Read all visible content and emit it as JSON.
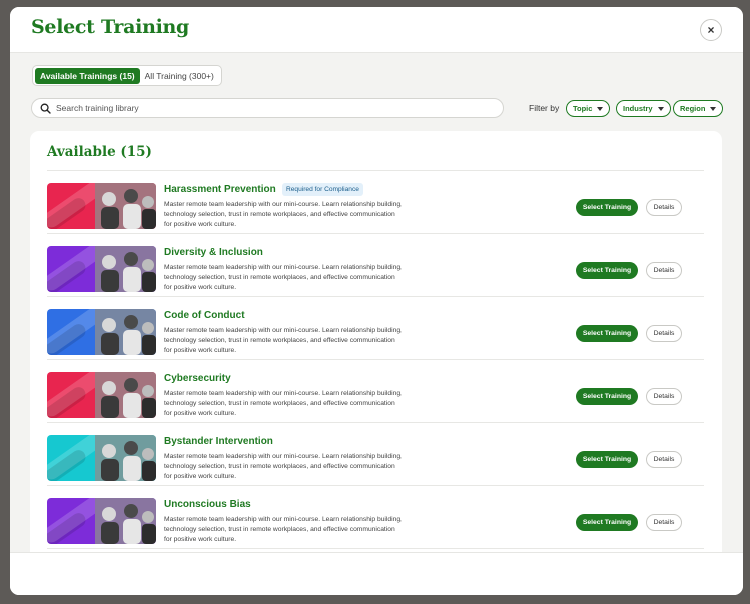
{
  "modal": {
    "title": "Select Training",
    "close_icon": "×"
  },
  "tabs": [
    {
      "label": "Available Trainings (15)",
      "active": true
    },
    {
      "label": "All Training (300+)",
      "active": false
    }
  ],
  "search": {
    "placeholder": "Search training library"
  },
  "filters": {
    "label": "Filter by",
    "chips": [
      "Topic",
      "Industry",
      "Region"
    ]
  },
  "section": {
    "title": "Available (15)"
  },
  "trainings": [
    {
      "title": "Harassment Prevention",
      "badge": "Required for Compliance",
      "description": "Master remote team leadership with our mini-course. Learn relationship building, technology selection, trust in remote workplaces, and effective communication for positive work culture.",
      "thumb_color": "#e8254f",
      "select_label": "Select Training",
      "details_label": "Details"
    },
    {
      "title": "Diversity & Inclusion",
      "badge": "",
      "description": "Master remote team leadership with our mini-course. Learn relationship building, technology selection, trust in remote workplaces, and effective communication for positive work culture.",
      "thumb_color": "#7d2cd9",
      "select_label": "Select Training",
      "details_label": "Details"
    },
    {
      "title": "Code of Conduct",
      "badge": "",
      "description": "Master remote team leadership with our mini-course. Learn relationship building, technology selection, trust in remote workplaces, and effective communication for positive work culture.",
      "thumb_color": "#2f6fe4",
      "select_label": "Select Training",
      "details_label": "Details"
    },
    {
      "title": "Cybersecurity",
      "badge": "",
      "description": "Master remote team leadership with our mini-course. Learn relationship building, technology selection, trust in remote workplaces, and effective communication for positive work culture.",
      "thumb_color": "#e8254f",
      "select_label": "Select Training",
      "details_label": "Details"
    },
    {
      "title": "Bystander Intervention",
      "badge": "",
      "description": "Master remote team leadership with our mini-course. Learn relationship building, technology selection, trust in remote workplaces, and effective communication for positive work culture.",
      "thumb_color": "#16c8d0",
      "select_label": "Select Training",
      "details_label": "Details"
    },
    {
      "title": "Unconscious Bias",
      "badge": "",
      "description": "Master remote team leadership with our mini-course. Learn relationship building, technology selection, trust in remote workplaces, and effective communication for positive work culture.",
      "thumb_color": "#7d2cd9",
      "select_label": "Select Training",
      "details_label": "Details"
    }
  ],
  "colors": {
    "brand_green": "#1f7a22",
    "badge_bg": "#e3f0fa",
    "badge_text": "#1b5e8c"
  }
}
